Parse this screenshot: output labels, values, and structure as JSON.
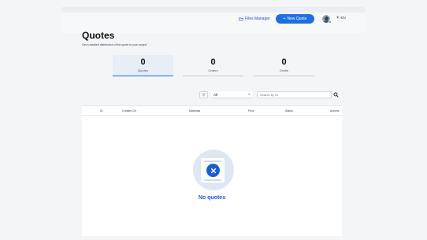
{
  "header": {
    "files_manager_label": "Files Manager",
    "new_quote_label": "New Quote",
    "language": "EN"
  },
  "page": {
    "title": "Quotes",
    "subtitle": "Get a detailed distribution of the quote to your project"
  },
  "stats": [
    {
      "value": "0",
      "label": "Quotes",
      "active": true
    },
    {
      "value": "0",
      "label": "Orders",
      "active": false
    },
    {
      "value": "0",
      "label": "Drafts",
      "active": false
    }
  ],
  "filters": {
    "select_value": "All",
    "search_placeholder": "Search by ID"
  },
  "table": {
    "columns": [
      "ID",
      "Created On",
      "Materials",
      "Price",
      "Status",
      "Actions"
    ]
  },
  "empty_state": {
    "message": "No quotes"
  },
  "colors": {
    "accent": "#1d6fe0",
    "empty_text": "#1d5ec9"
  }
}
